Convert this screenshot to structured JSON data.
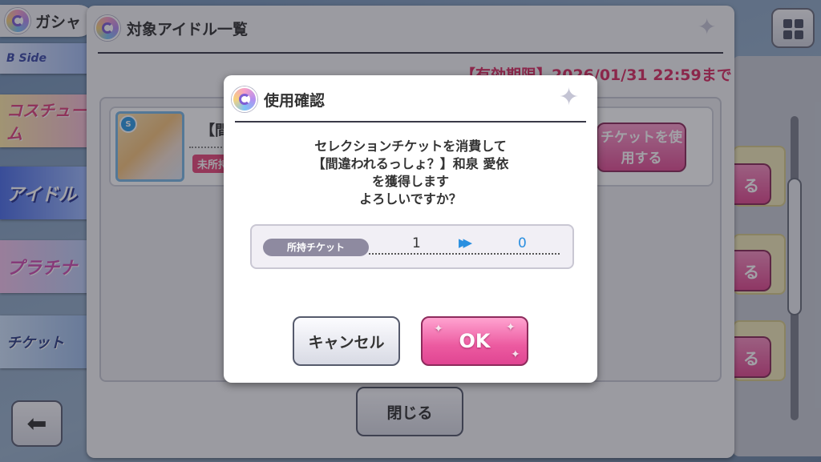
{
  "top_bar": {
    "gacha_title": "ガシャ"
  },
  "banners": [
    {
      "text": "B Side"
    },
    {
      "text": "コスチューム"
    },
    {
      "text": "アイドル"
    },
    {
      "text": "プラチナ"
    },
    {
      "text": "チケット"
    }
  ],
  "idol_panel": {
    "title": "対象アイドル一覧",
    "expiry": "【有効期限】2026/01/31 22:59まで",
    "idol": {
      "name": "【間",
      "type_badge": "S",
      "status": "未所持"
    },
    "use_ticket_button": "チケットを使用する",
    "close_button": "閉じる"
  },
  "right_column": {
    "button_label": "る"
  },
  "dialog": {
    "title": "使用確認",
    "message_lines": [
      "セレクションチケットを消費して",
      "【間違われるっしょ？】和泉 愛依",
      "を獲得します",
      "よろしいですか？"
    ],
    "ticket": {
      "label": "所持チケット",
      "before": "1",
      "arrow": "▶▶",
      "after": "0"
    },
    "cancel_button": "キャンセル",
    "ok_button": "OK"
  },
  "colors": {
    "accent_pink": "#e24f95",
    "expiry_red": "#d92d62",
    "ticket_blue": "#2a8fe0"
  }
}
